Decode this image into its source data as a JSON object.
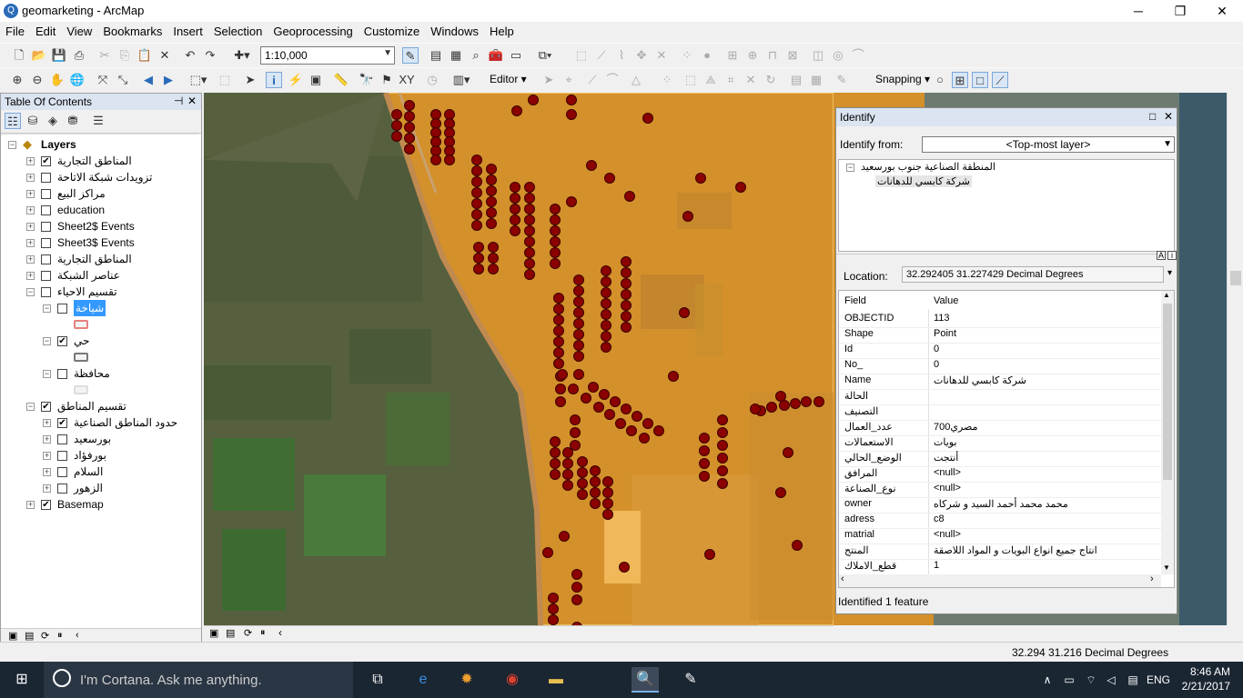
{
  "window": {
    "title": "geomarketing - ArcMap",
    "minimize": "─",
    "maximize": "❐",
    "close": "✕"
  },
  "menu": [
    "File",
    "Edit",
    "View",
    "Bookmarks",
    "Insert",
    "Selection",
    "Geoprocessing",
    "Customize",
    "Windows",
    "Help"
  ],
  "toolbar": {
    "scale": "1:10,000",
    "editor": "Editor ▾",
    "snapping": "Snapping ▾"
  },
  "toc": {
    "title": "Table Of Contents",
    "pin": "⊣",
    "close": "✕",
    "root": "Layers",
    "layers": [
      {
        "label": "المناطق التجارية",
        "checked": true,
        "level": 1,
        "expander": "+"
      },
      {
        "label": "تزويدات شبكة الاتاحة",
        "checked": false,
        "level": 1,
        "expander": "+"
      },
      {
        "label": "مراكز البيع",
        "checked": false,
        "level": 1,
        "expander": "+"
      },
      {
        "label": "education",
        "checked": false,
        "level": 1,
        "expander": "+"
      },
      {
        "label": "Sheet2$ Events",
        "checked": false,
        "level": 1,
        "expander": "+"
      },
      {
        "label": "Sheet3$ Events",
        "checked": false,
        "level": 1,
        "expander": "+"
      },
      {
        "label": "المناطق التجارية",
        "checked": false,
        "level": 1,
        "expander": "+"
      },
      {
        "label": "عناصر الشبكة",
        "checked": false,
        "level": 1,
        "expander": "+"
      },
      {
        "label": "تقسيم الاحياء",
        "checked": false,
        "level": 1,
        "expander": "−"
      },
      {
        "label": "شياخة",
        "checked": false,
        "level": 2,
        "expander": "−",
        "selected": true,
        "symbol": "#e88080"
      },
      {
        "label": "حي",
        "checked": true,
        "level": 2,
        "expander": "−",
        "symbol": "#777777"
      },
      {
        "label": "محافظة",
        "checked": false,
        "level": 2,
        "expander": "−",
        "symbol": "#dddddd"
      },
      {
        "label": "تقسيم المناطق",
        "checked": true,
        "level": 1,
        "expander": "−"
      },
      {
        "label": "حدود المناطق الصناعية",
        "checked": true,
        "level": 2,
        "expander": "+"
      },
      {
        "label": "بورسعيد",
        "checked": false,
        "level": 2,
        "expander": "+"
      },
      {
        "label": "بورفؤاد",
        "checked": false,
        "level": 2,
        "expander": "+"
      },
      {
        "label": "السلام",
        "checked": false,
        "level": 2,
        "expander": "+"
      },
      {
        "label": "الزهور",
        "checked": false,
        "level": 2,
        "expander": "+"
      },
      {
        "label": "Basemap",
        "checked": true,
        "level": 1,
        "expander": "+"
      }
    ]
  },
  "identify": {
    "title": "Identify",
    "identify_from_label": "Identify from:",
    "identify_from_value": "<Top-most layer>",
    "tree_parent": "المنطقة الصناعية جنوب بورسعيد",
    "tree_child": "شركة كابسي للدهانات",
    "location_label": "Location:",
    "location_value": "32.292405  31.227429 Decimal Degrees",
    "col_field": "Field",
    "col_value": "Value",
    "rows": [
      {
        "field": "OBJECTID",
        "value": "113"
      },
      {
        "field": "Shape",
        "value": "Point"
      },
      {
        "field": "Id",
        "value": "0"
      },
      {
        "field": "No_",
        "value": "0"
      },
      {
        "field": "Name",
        "value": "شركة كابسي للدهانات"
      },
      {
        "field": "الحالة",
        "value": ""
      },
      {
        "field": "التصنيف",
        "value": ""
      },
      {
        "field": "عدد_العمال",
        "value": "700مصري"
      },
      {
        "field": "الاستعمالات",
        "value": "بويات"
      },
      {
        "field": "الوضع_الحالي",
        "value": "أنتجت"
      },
      {
        "field": "المرافق",
        "value": "<null>"
      },
      {
        "field": "نوع_الصناعة",
        "value": "<null>"
      },
      {
        "field": "owner",
        "value": "محمد محمد أحمد السيد و شركاه"
      },
      {
        "field": "adress",
        "value": "c8"
      },
      {
        "field": "matrial",
        "value": "<null>"
      },
      {
        "field": "المنتج",
        "value": "انتاج جميع انواع البويات و المواد اللاصقة"
      },
      {
        "field": "قطع_الاملاك",
        "value": "1"
      }
    ],
    "status": "Identified 1 feature"
  },
  "statusbar": {
    "coords": "32.294  31.216 Decimal Degrees"
  },
  "taskbar": {
    "search": "I'm Cortana. Ask me anything.",
    "lang": "ENG",
    "time": "8:46 AM",
    "date": "2/21/2017"
  },
  "colors": {
    "industrial_fill": "#d4902a",
    "point_fill": "#8b0000",
    "selection_bg": "#3399ff"
  }
}
